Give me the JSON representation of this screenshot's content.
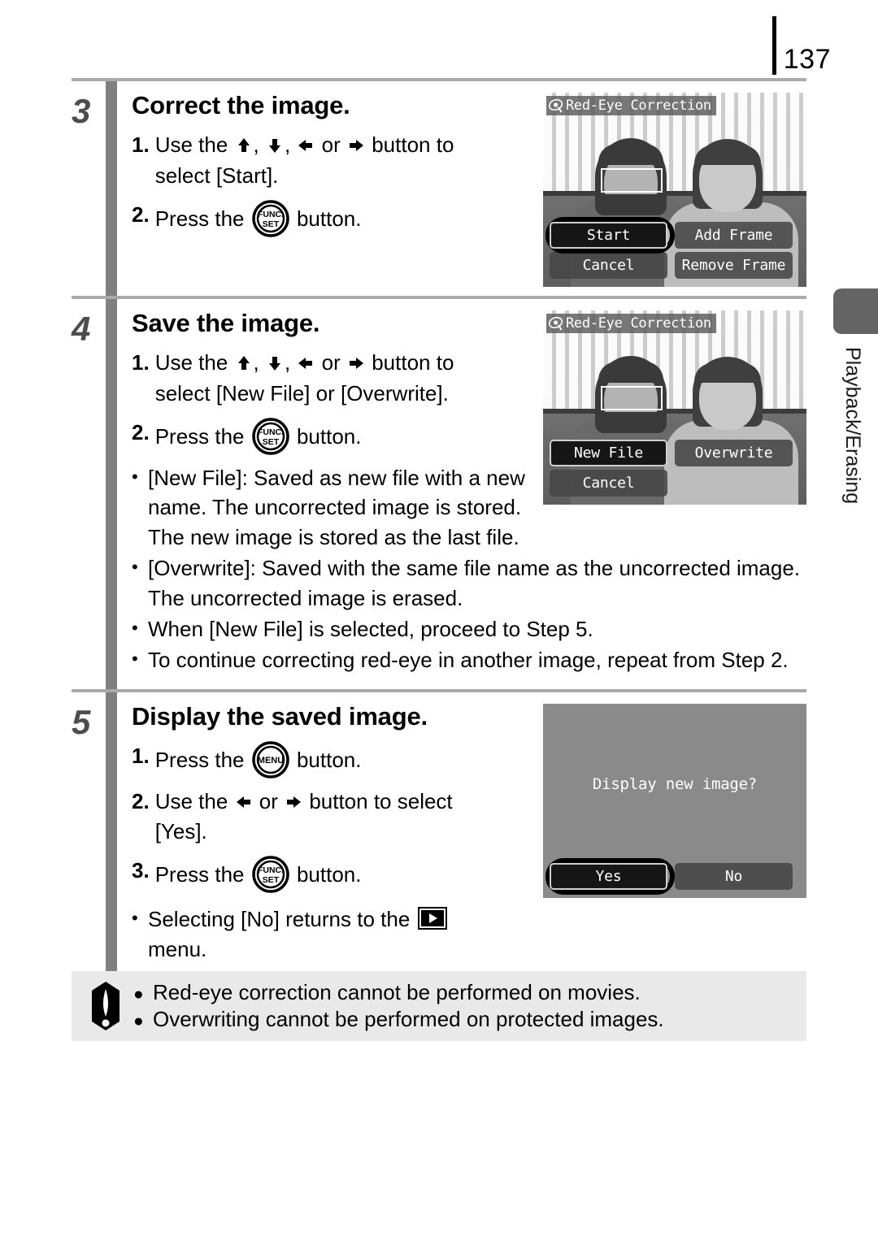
{
  "page": {
    "number": "137"
  },
  "side_tab": {
    "label": "Playback/Erasing"
  },
  "steps": [
    {
      "number": "3",
      "title": "Correct the image.",
      "items": [
        {
          "marker": "1.",
          "pre": "Use the ",
          "arrows": "up-down-left-right",
          "mid": " button to",
          "line2": "select [Start]."
        },
        {
          "marker": "2.",
          "pre": "Press the ",
          "icon": "func-set",
          "post": " button."
        }
      ]
    },
    {
      "number": "4",
      "title": "Save the image.",
      "items": [
        {
          "marker": "1.",
          "pre": "Use the ",
          "arrows": "up-down-left-right",
          "mid": " button to",
          "line2": "select [New File] or [Overwrite]."
        },
        {
          "marker": "2.",
          "pre": "Press the ",
          "icon": "func-set",
          "post": " button."
        }
      ],
      "bullets": [
        "[New File]: Saved as new file with a new name. The uncorrected image is stored. The new image is stored as the last file.",
        "[Overwrite]: Saved with the same file name as the uncorrected image. The uncorrected image is erased.",
        "When [New File] is selected, proceed to Step 5.",
        "To continue correcting red-eye in another image, repeat from Step 2."
      ]
    },
    {
      "number": "5",
      "title": "Display the saved image.",
      "items": [
        {
          "marker": "1.",
          "pre": "Press the ",
          "icon": "menu",
          "post": " button."
        },
        {
          "marker": "2.",
          "pre": "Use the ",
          "arrows": "left-right",
          "mid": " button to select",
          "line2": "[Yes]."
        },
        {
          "marker": "3.",
          "pre": "Press the ",
          "icon": "func-set",
          "post": " button."
        }
      ],
      "bullets_icon": {
        "pre": "Selecting [No] returns to the ",
        "icon": "playback",
        "post": "menu."
      }
    }
  ],
  "screens": [
    {
      "id": "screen-step3",
      "title": "Red-Eye Correction",
      "title_icon": "red-eye-icon",
      "menu": [
        {
          "label": "Start",
          "selected": true
        },
        {
          "label": "Add Frame",
          "selected": false
        },
        {
          "label": "Cancel",
          "selected": false
        },
        {
          "label": "Remove Frame",
          "selected": false
        }
      ]
    },
    {
      "id": "screen-step4",
      "title": "Red-Eye Correction",
      "title_icon": "red-eye-icon",
      "menu": [
        {
          "label": "New File",
          "selected": true
        },
        {
          "label": "Overwrite",
          "selected": false
        },
        {
          "label": "Cancel",
          "selected": false
        },
        {
          "label": "",
          "selected": false
        }
      ]
    },
    {
      "id": "screen-step5",
      "message": "Display new image?",
      "menu": [
        {
          "label": "Yes",
          "selected": true
        },
        {
          "label": "No",
          "selected": false
        }
      ]
    }
  ],
  "caution": {
    "lines": [
      "Red-eye correction cannot be performed on movies.",
      "Overwriting cannot be performed on protected images."
    ]
  }
}
